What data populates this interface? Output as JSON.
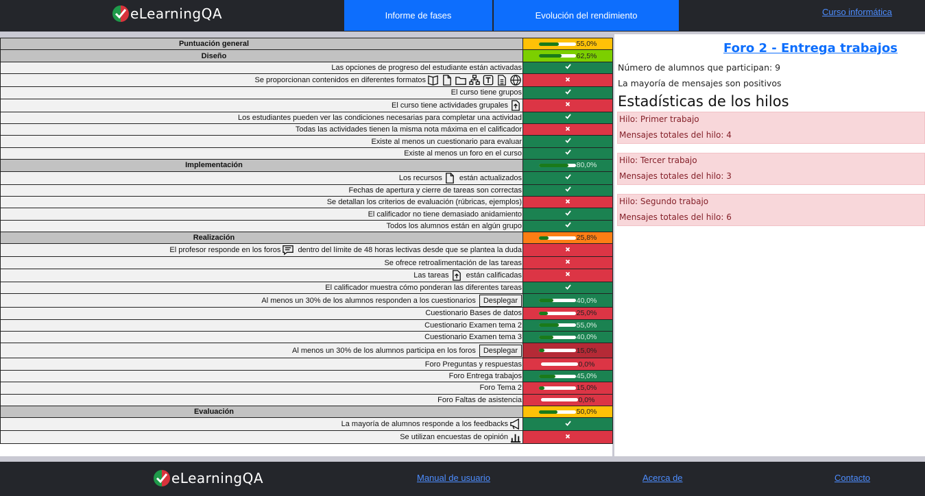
{
  "brand": "eLearningQA",
  "header": {
    "tab_phases": "Informe de fases",
    "tab_evolution": "Evolución del rendimiento",
    "course_link": "Curso informática"
  },
  "rows": [
    {
      "label": "Puntuación general",
      "section": true,
      "pct": "55,0%",
      "fill": 0.55,
      "bg": "y"
    },
    {
      "label": "Diseño",
      "section": true,
      "pct": "62,5%",
      "fill": 0.625,
      "bg": "g"
    },
    {
      "label": "Las opciones de progreso del estudiante están activadas",
      "status": "ok"
    },
    {
      "label": "Se proporcionan contenidos en diferentes formatos",
      "status": "ko",
      "icons": [
        "book-icon",
        "file-icon",
        "folder-icon",
        "sitemap-icon",
        "text-icon",
        "document-icon",
        "globe-icon"
      ]
    },
    {
      "label": "El curso tiene grupos",
      "status": "ok"
    },
    {
      "label": "El curso tiene actividades grupales",
      "status": "ko",
      "icons": [
        "assignment-icon"
      ]
    },
    {
      "label": "Los estudiantes pueden ver las condiciones necesarias para completar una actividad",
      "status": "ok"
    },
    {
      "label": "Todas las actividades tienen la misma nota máxima en el calificador",
      "status": "ko"
    },
    {
      "label": "Existe al menos un cuestionario para evaluar",
      "status": "ok"
    },
    {
      "label": "Existe al menos un foro en el curso",
      "status": "ok"
    },
    {
      "label": "Implementación",
      "section": true,
      "pct": "80,0%",
      "fill": 0.8,
      "bg": "ok"
    },
    {
      "label": "Los recursos",
      "label2": "están actualizados",
      "status": "ok",
      "icons": [
        "file-icon"
      ]
    },
    {
      "label": "Fechas de apertura y cierre de tareas son correctas",
      "status": "ok"
    },
    {
      "label": "Se detallan los criterios de evaluación (rúbricas, ejemplos)",
      "status": "ko"
    },
    {
      "label": "El calificador no tiene demasiado anidamiento",
      "status": "ok"
    },
    {
      "label": "Todos los alumnos están en algún grupo",
      "status": "ok"
    },
    {
      "label": "Realización",
      "section": true,
      "pct": "25,8%",
      "fill": 0.258,
      "bg": "o"
    },
    {
      "label": "El profesor responde en los foros",
      "label2": "dentro del límite de 48 horas lectivas desde que se plantea la duda",
      "status": "ko",
      "icons": [
        "forum-icon"
      ]
    },
    {
      "label": "Se ofrece retroalimentación de las tareas",
      "status": "ko"
    },
    {
      "label": "Las tareas",
      "label2": "están calificadas",
      "status": "ko",
      "icons": [
        "assignment-icon"
      ]
    },
    {
      "label": "El calificador muestra cómo ponderan las diferentes tareas",
      "status": "ok"
    },
    {
      "label": "Al menos un 30% de los alumnos responden a los cuestionarios",
      "button": "Desplegar",
      "pct": "40,0%",
      "fill": 0.4,
      "bg": "ok",
      "tall": true
    },
    {
      "label": "Cuestionario Bases de datos",
      "pct": "25,0%",
      "fill": 0.25,
      "bg": "ko"
    },
    {
      "label": "Cuestionario Examen tema 2",
      "pct": "55,0%",
      "fill": 0.55,
      "bg": "ok"
    },
    {
      "label": "Cuestionario Examen tema 3",
      "pct": "40,0%",
      "fill": 0.4,
      "bg": "ok"
    },
    {
      "label": "Al menos un 30% de los alumnos participa en los foros",
      "button": "Desplegar",
      "pct": "15,0%",
      "fill": 0.15,
      "bg": "ko2",
      "tall2": true
    },
    {
      "label": "Foro Preguntas y respuestas",
      "pct": "0,0%",
      "fill": 0,
      "bg": "ko"
    },
    {
      "label": "Foro Entrega trabajos",
      "pct": "45,0%",
      "fill": 0.45,
      "bg": "ok"
    },
    {
      "label": "Foro Tema 2",
      "pct": "15,0%",
      "fill": 0.15,
      "bg": "ko"
    },
    {
      "label": "Foro Faltas de asistencia",
      "pct": "0,0%",
      "fill": 0,
      "bg": "ko"
    },
    {
      "label": "Evaluación",
      "section": true,
      "pct": "50,0%",
      "fill": 0.5,
      "bg": "y"
    },
    {
      "label": "La mayoría de alumnos responde a los feedbacks",
      "status": "ok",
      "icons": [
        "megaphone-icon"
      ]
    },
    {
      "label": "Se utilizan encuestas de opinión",
      "status": "ko",
      "icons": [
        "chart-icon"
      ]
    }
  ],
  "forum": {
    "title": "Foro 2 - Entrega trabajos",
    "participants": "Número de alumnos que participan: 9",
    "sentiment": "La mayoría de mensajes son positivos",
    "stats_title": "Estadísticas de los hilos",
    "threads": [
      {
        "name": "Hilo: Primer trabajo",
        "total": "Mensajes totales del hilo: 4"
      },
      {
        "name": "Hilo: Tercer trabajo",
        "total": "Mensajes totales del hilo: 3"
      },
      {
        "name": "Hilo: Segundo trabajo",
        "total": "Mensajes totales del hilo: 6"
      }
    ]
  },
  "footer": {
    "manual": "Manual de usuario",
    "about": "Acerca de",
    "contact": "Contacto"
  }
}
